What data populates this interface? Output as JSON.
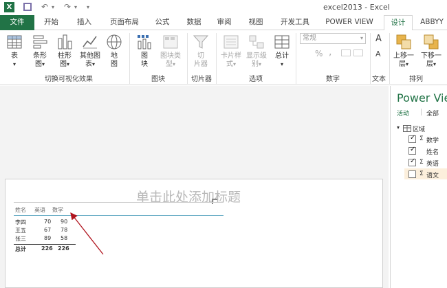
{
  "titlebar": {
    "title": "excel2013 - Excel",
    "undo_icon": "↶",
    "redo_icon": "↷"
  },
  "tabs": [
    "文件",
    "开始",
    "插入",
    "页面布局",
    "公式",
    "数据",
    "审阅",
    "视图",
    "开发工具",
    "POWER VIEW",
    "设计",
    "ABBYY"
  ],
  "ribbon": {
    "switch_vis": {
      "table": "表",
      "bar": [
        "条形",
        "图"
      ],
      "column": [
        "柱形",
        "图"
      ],
      "other": [
        "其他图",
        "表"
      ],
      "map": [
        "地",
        "图"
      ],
      "group": "切换可视化效果"
    },
    "tiles": {
      "tile": [
        "图",
        "块"
      ],
      "tile_type": [
        "图块类",
        "型"
      ],
      "group": "图块"
    },
    "filters": {
      "slicer": [
        "切",
        "片器"
      ],
      "group": "切片器"
    },
    "options": {
      "card_style": [
        "卡片样",
        "式"
      ],
      "show_levels": [
        "显示级",
        "别"
      ],
      "totals": [
        "总计"
      ],
      "group": "选项"
    },
    "number": {
      "format_value": "常规",
      "percent": "%",
      "comma": ",",
      "group": "数字"
    },
    "text": {
      "group": "文本",
      "grow": "A",
      "shrink": "A"
    },
    "arrange": {
      "bring_forward": [
        "上移一",
        "层"
      ],
      "send_backward": [
        "下移一",
        "层"
      ],
      "group": "排列"
    },
    "dropdown_arrow": "▾"
  },
  "canvas": {
    "title_placeholder": "单击此处添加标题",
    "table": {
      "headers": [
        "姓名",
        "英语",
        "数学"
      ],
      "rows": [
        [
          "李四",
          "70",
          "90"
        ],
        [
          "王五",
          "67",
          "78"
        ],
        [
          "张三",
          "89",
          "58"
        ]
      ],
      "total": [
        "总计",
        "226",
        "226"
      ]
    }
  },
  "panel": {
    "title": "Power View",
    "tabs": [
      "活动",
      "全部"
    ],
    "table_name": "区域",
    "fields": [
      {
        "label": "数学",
        "checked": true,
        "sigma": "Σ"
      },
      {
        "label": "姓名",
        "checked": true,
        "sigma": ""
      },
      {
        "label": "英语",
        "checked": true,
        "sigma": "Σ"
      },
      {
        "label": "语文",
        "checked": false,
        "sigma": "Σ"
      }
    ]
  },
  "colors": {
    "excel_green": "#217346",
    "arrow_red": "#b0141e"
  }
}
